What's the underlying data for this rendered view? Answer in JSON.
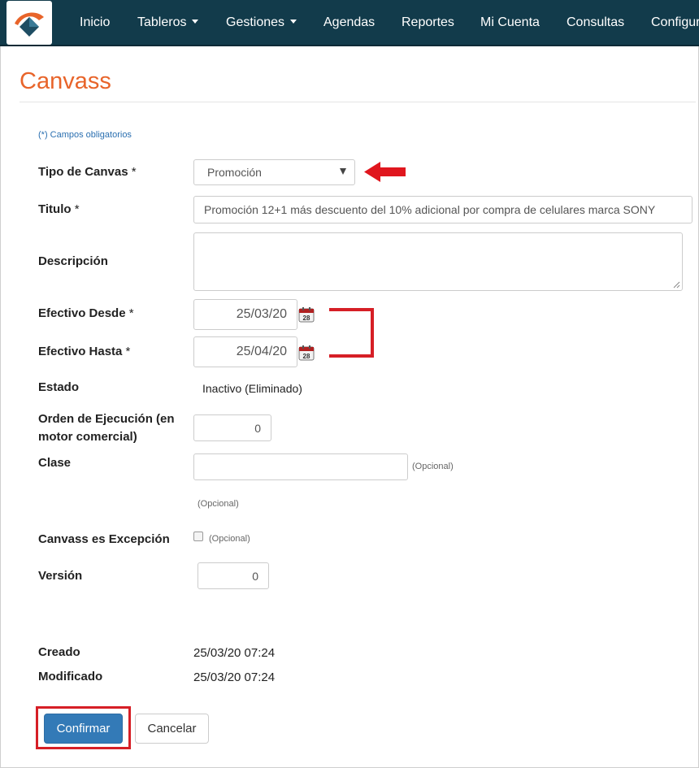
{
  "nav": {
    "items": [
      {
        "label": "Inicio"
      },
      {
        "label": "Tableros"
      },
      {
        "label": "Gestiones"
      },
      {
        "label": "Agendas"
      },
      {
        "label": "Reportes"
      },
      {
        "label": "Mi Cuenta"
      },
      {
        "label": "Consultas"
      },
      {
        "label": "Configur"
      }
    ]
  },
  "page": {
    "title": "Canvass",
    "required_note": "(*) Campos obligatorios"
  },
  "form": {
    "tipo": {
      "label": "Tipo de Canvas",
      "required": "*",
      "value": "Promoción"
    },
    "titulo": {
      "label": "Titulo",
      "required": "*",
      "value": "Promoción 12+1 más descuento del 10% adicional por compra de celulares marca SONY"
    },
    "descripcion": {
      "label": "Descripción",
      "value": ""
    },
    "desde": {
      "label": "Efectivo Desde",
      "required": "*",
      "value": "25/03/20",
      "cal_day": "28"
    },
    "hasta": {
      "label": "Efectivo Hasta",
      "required": "*",
      "value": "25/04/20",
      "cal_day": "28"
    },
    "estado": {
      "label": "Estado",
      "value": "Inactivo (Eliminado)"
    },
    "orden": {
      "label_line1": "Orden de Ejecución (en",
      "label_line2": "motor comercial)",
      "value": "0"
    },
    "clase": {
      "label": "Clase",
      "value": "",
      "hint": "(Opcional)",
      "hint2": "(Opcional)"
    },
    "excepcion": {
      "label": "Canvass es Excepción",
      "checked": false,
      "hint": "(Opcional)"
    },
    "version": {
      "label": "Versión",
      "value": "0"
    },
    "creado": {
      "label": "Creado",
      "value": "25/03/20 07:24"
    },
    "modificado": {
      "label": "Modificado",
      "value": "25/03/20 07:24"
    }
  },
  "actions": {
    "confirm": "Confirmar",
    "cancel": "Cancelar"
  },
  "colors": {
    "navbar": "#123b4b",
    "title": "#e8642a",
    "primary": "#337ab7",
    "annotation": "#d61f26"
  }
}
